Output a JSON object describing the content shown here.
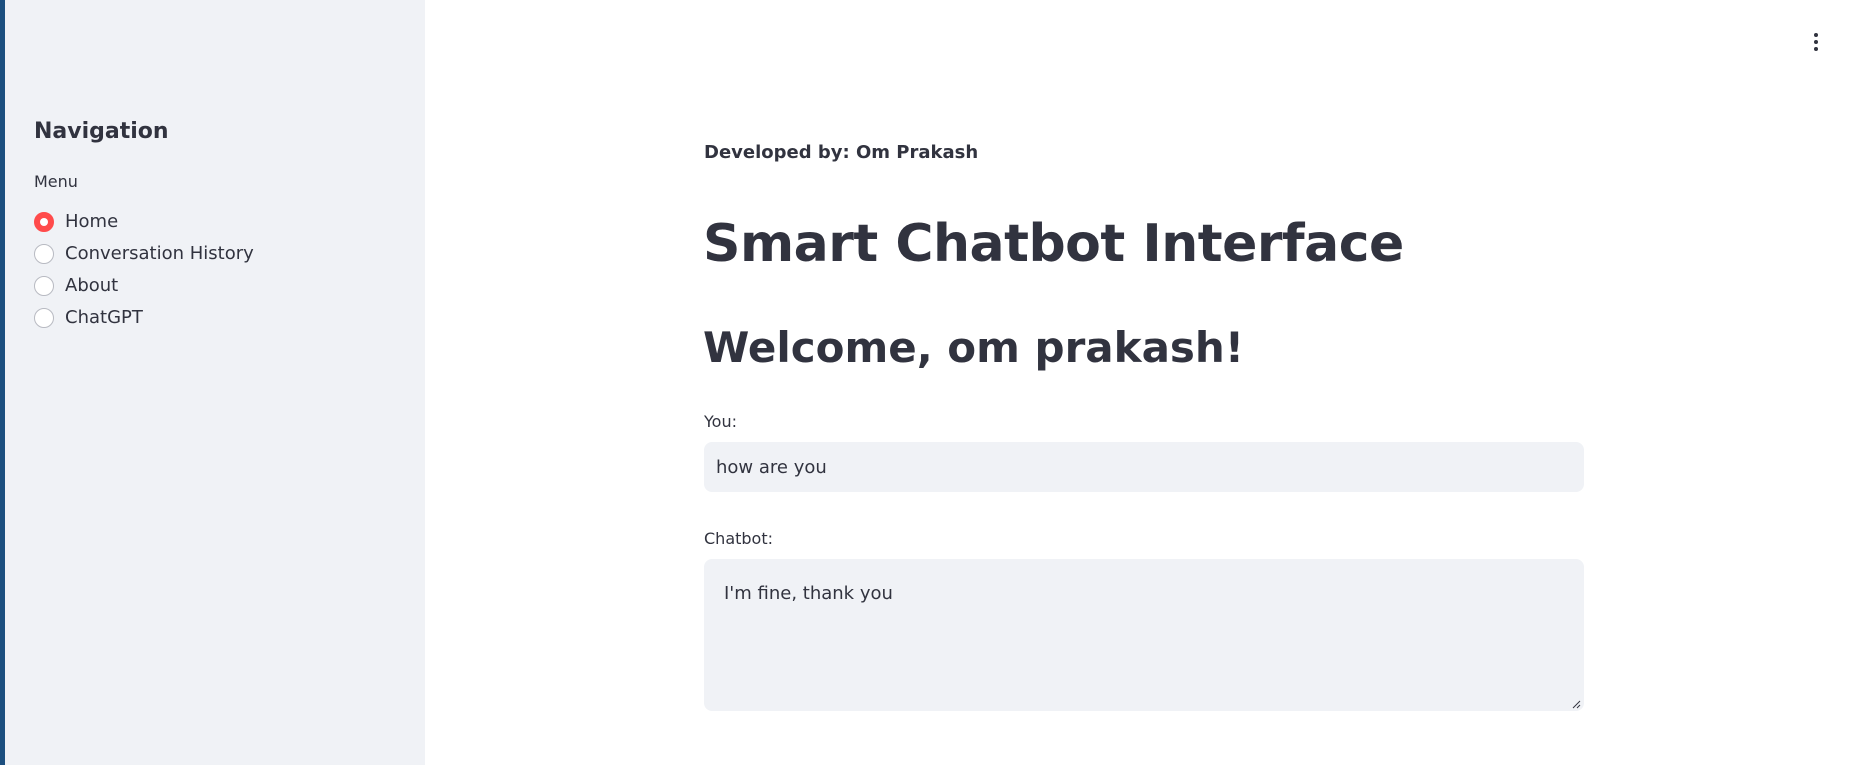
{
  "sidebar": {
    "title": "Navigation",
    "radio_label": "Menu",
    "items": [
      {
        "label": "Home",
        "selected": true
      },
      {
        "label": "Conversation History",
        "selected": false
      },
      {
        "label": "About",
        "selected": false
      },
      {
        "label": "ChatGPT",
        "selected": false
      }
    ]
  },
  "main": {
    "developer": "Developed by: Om Prakash",
    "title": "Smart Chatbot Interface",
    "welcome": "Welcome, om prakash!",
    "you_label": "You:",
    "you_value": "how are you",
    "chatbot_label": "Chatbot:",
    "chatbot_value": "I'm fine, thank you"
  },
  "icons": {
    "main_menu": "vertical-ellipsis-icon",
    "radio_selected": "radio-selected-icon",
    "resize": "resize-grip-icon"
  },
  "colors": {
    "accent": "#ff4b4b",
    "sidebar_bg": "#f0f2f6",
    "text": "#31333f",
    "edge_stripe": "#1c4f7f"
  }
}
